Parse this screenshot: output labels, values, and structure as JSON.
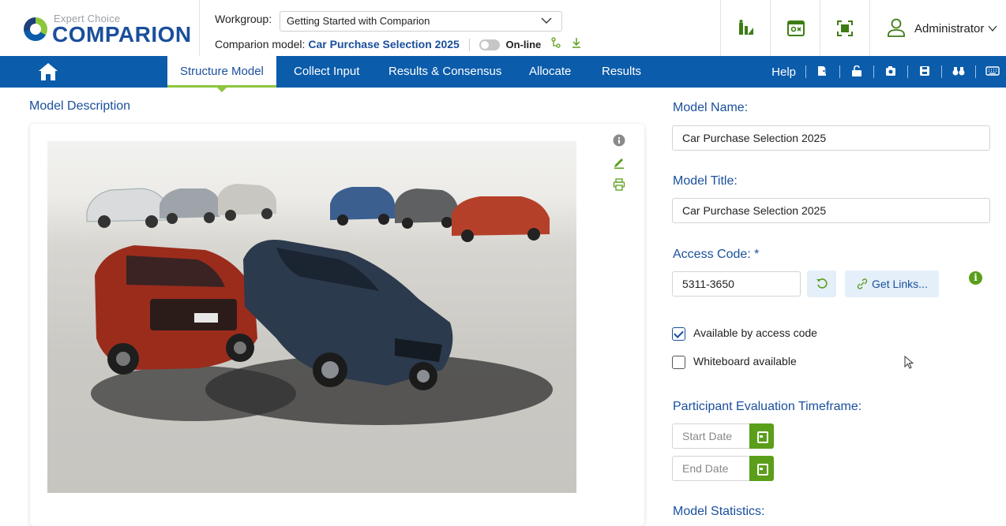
{
  "brand": {
    "small": "Expert Choice",
    "big": "COMPARION"
  },
  "header": {
    "workgroup_label": "Workgroup:",
    "workgroup_value": "Getting Started with Comparion",
    "model_label": "Comparion model:",
    "model_name": "Car Purchase Selection 2025",
    "online_label": "On-line",
    "user_name": "Administrator"
  },
  "nav": {
    "tabs": [
      {
        "label": "Structure Model"
      },
      {
        "label": "Collect Input"
      },
      {
        "label": "Results & Consensus"
      },
      {
        "label": "Allocate"
      },
      {
        "label": "Results"
      }
    ],
    "help_label": "Help"
  },
  "model_description": {
    "title": "Model Description"
  },
  "form": {
    "model_name_label": "Model Name:",
    "model_name_value": "Car Purchase Selection 2025",
    "model_title_label": "Model Title:",
    "model_title_value": "Car Purchase Selection 2025",
    "access_code_label": "Access Code: *",
    "access_code_value": "5311-3650",
    "get_links_label": "Get Links...",
    "available_label": "Available by access code",
    "available_checked": true,
    "whiteboard_label": "Whiteboard available",
    "whiteboard_checked": false,
    "timeframe_label": "Participant Evaluation Timeframe:",
    "start_date_placeholder": "Start Date",
    "end_date_placeholder": "End Date",
    "stats_label": "Model Statistics:"
  },
  "colors": {
    "brand_blue": "#0b5cab",
    "accent_green": "#5a9e1a",
    "label_blue": "#1a4f9c"
  }
}
